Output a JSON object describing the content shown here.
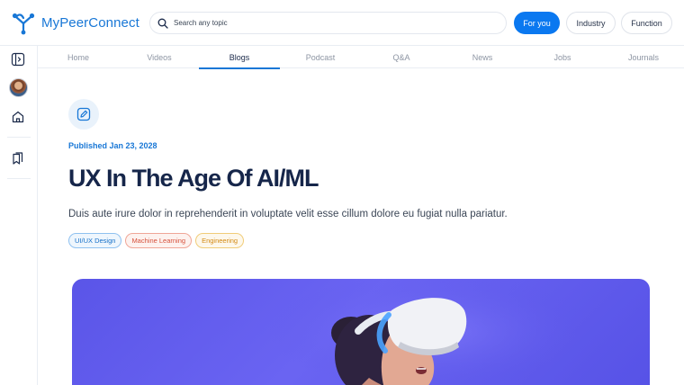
{
  "brand": {
    "name": "MyPeerConnect",
    "icon": "network-logo-icon",
    "color": "#1877d6"
  },
  "search": {
    "placeholder": "Search any topic",
    "icon": "search-icon"
  },
  "header_filters": [
    {
      "label": "For you",
      "active": true
    },
    {
      "label": "Industry",
      "active": false
    },
    {
      "label": "Function",
      "active": false
    }
  ],
  "sidebar": {
    "items": [
      {
        "icon": "collapse-sidebar-icon"
      },
      {
        "icon": "user-avatar"
      },
      {
        "icon": "home-icon"
      },
      {
        "icon": "bookmarks-icon"
      }
    ]
  },
  "tabs": [
    {
      "label": "Home",
      "active": false
    },
    {
      "label": "Videos",
      "active": false
    },
    {
      "label": "Blogs",
      "active": true
    },
    {
      "label": "Podcast",
      "active": false
    },
    {
      "label": "Q&A",
      "active": false
    },
    {
      "label": "News",
      "active": false
    },
    {
      "label": "Jobs",
      "active": false
    },
    {
      "label": "Journals",
      "active": false
    }
  ],
  "article": {
    "badge_icon": "edit-icon",
    "published": "Published Jan 23, 2028",
    "title": "UX In The Age Of AI/ML",
    "description": "Duis aute irure dolor in reprehenderit in voluptate velit esse cillum dolore eu fugiat nulla pariatur.",
    "tags": [
      {
        "label": "UI/UX Design",
        "color": "#1570c8"
      },
      {
        "label": "Machine Learning",
        "color": "#d6513c"
      },
      {
        "label": "Engineering",
        "color": "#d38a14"
      }
    ],
    "hero_image": "woman-wearing-vr-headset-image"
  },
  "colors": {
    "accent": "#0a78f0",
    "title": "#16264a",
    "hero_bg": "#5a55e8"
  }
}
